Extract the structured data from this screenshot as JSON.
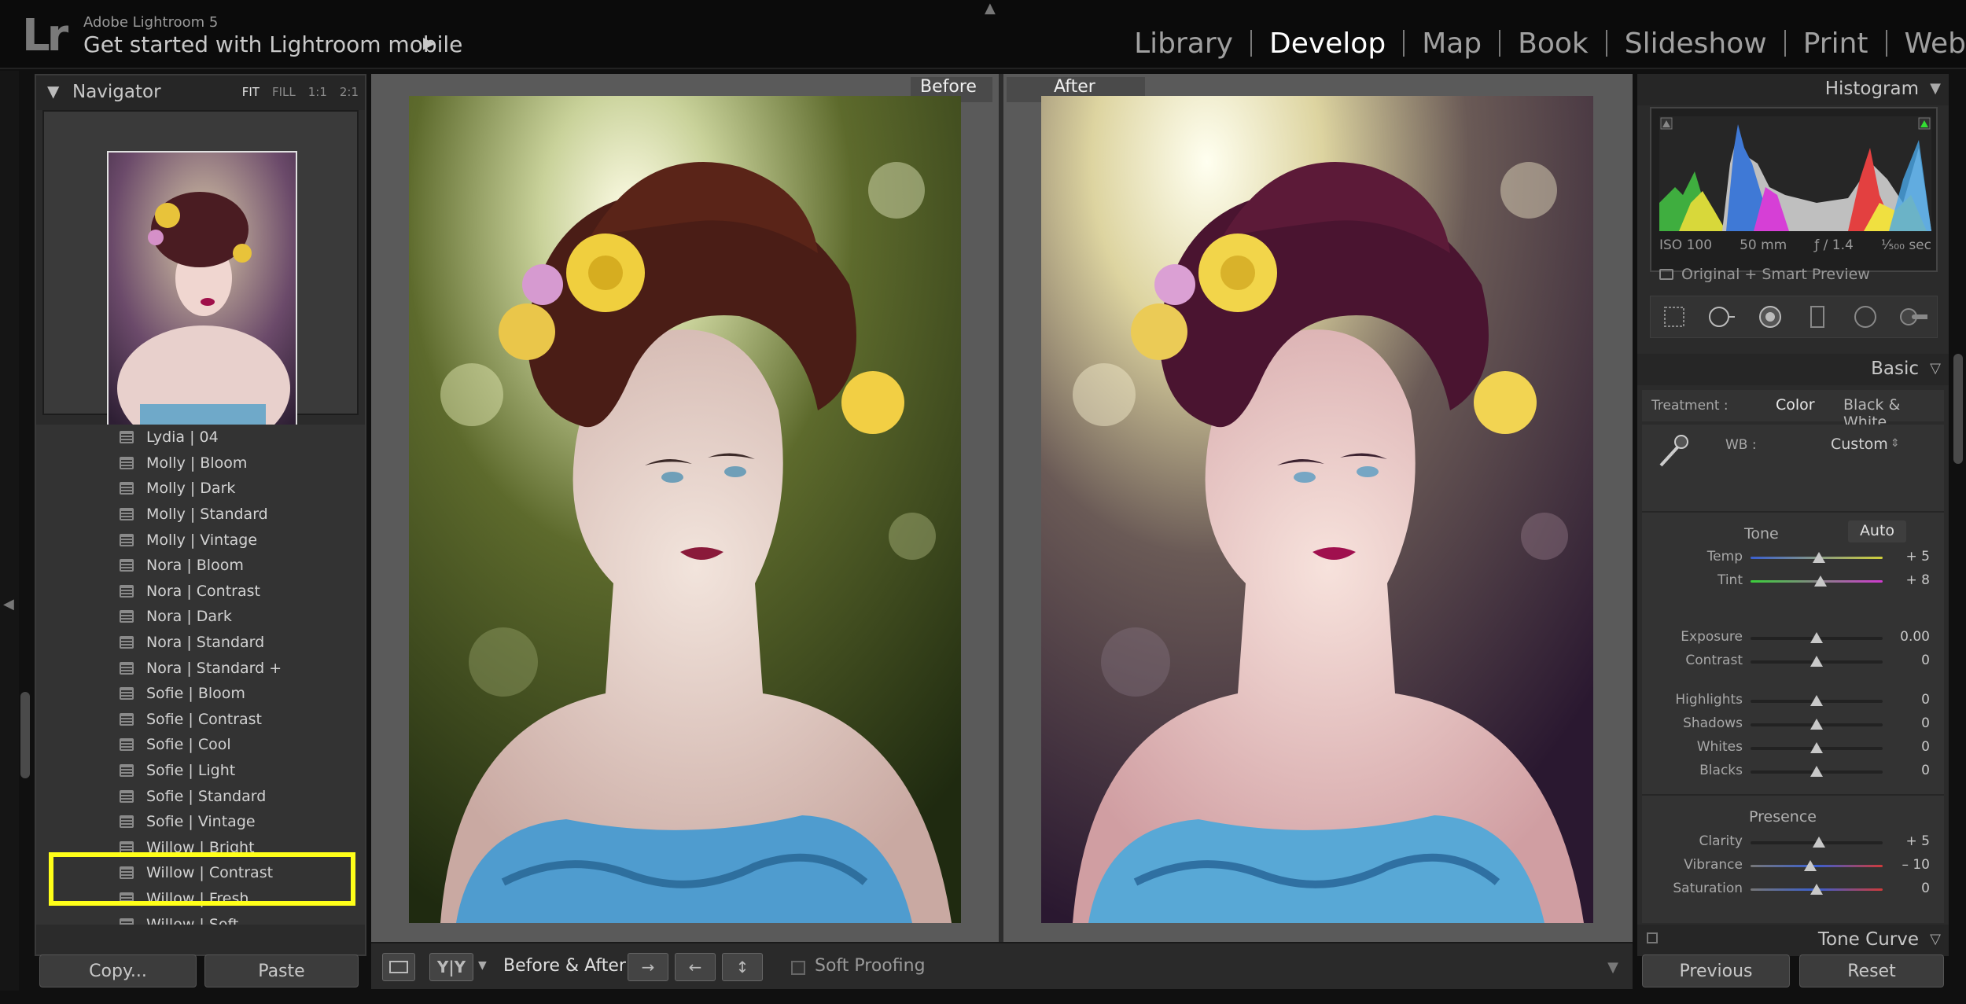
{
  "app": {
    "logo": "Lr",
    "title": "Adobe Lightroom 5",
    "identity": "Get started with Lightroom mobile",
    "identity_arrow": "▶"
  },
  "modules": [
    {
      "label": "Library",
      "active": false
    },
    {
      "label": "Develop",
      "active": true
    },
    {
      "label": "Map",
      "active": false
    },
    {
      "label": "Book",
      "active": false
    },
    {
      "label": "Slideshow",
      "active": false
    },
    {
      "label": "Print",
      "active": false
    },
    {
      "label": "Web",
      "active": false
    }
  ],
  "navigator": {
    "title": "Navigator",
    "zoom": [
      "FIT",
      "FILL",
      "1:1",
      "2:1"
    ],
    "zoom_active": "FIT"
  },
  "presets": [
    "Lydia | 04",
    "Molly | Bloom",
    "Molly | Dark",
    "Molly | Standard",
    "Molly | Vintage",
    "Nora | Bloom",
    "Nora | Contrast",
    "Nora | Dark",
    "Nora | Standard",
    "Nora | Standard +",
    "Sofie | Bloom",
    "Sofie | Contrast",
    "Sofie | Cool",
    "Sofie | Light",
    "Sofie | Standard",
    "Sofie | Vintage",
    "Willow | Bright",
    "Willow | Contrast",
    "Willow | Fresh",
    "Willow | Soft"
  ],
  "highlighted_preset": "Willow | Contrast",
  "left_buttons": {
    "copy": "Copy...",
    "paste": "Paste"
  },
  "view": {
    "before": "Before",
    "after": "After"
  },
  "toolbar": {
    "before_after_label": "Before & After :",
    "soft_proofing": "Soft Proofing",
    "yy": "Y|Y"
  },
  "histogram": {
    "title": "Histogram",
    "iso": "ISO 100",
    "focal": "50 mm",
    "aperture": "ƒ / 1.4",
    "shutter": "¹⁄₅₀₀ sec",
    "preview": "Original + Smart Preview"
  },
  "basic": {
    "title": "Basic",
    "treatment_label": "Treatment :",
    "treatment_color": "Color",
    "treatment_bw": "Black & White",
    "wb_label": "WB :",
    "wb_value": "Custom",
    "tone_label": "Tone",
    "auto_label": "Auto",
    "presence_label": "Presence",
    "sliders": [
      {
        "label": "Temp",
        "value": "+ 5",
        "pos": 0.52
      },
      {
        "label": "Tint",
        "value": "+ 8",
        "pos": 0.53
      },
      {
        "label": "Exposure",
        "value": "0.00",
        "pos": 0.5
      },
      {
        "label": "Contrast",
        "value": "0",
        "pos": 0.5
      },
      {
        "label": "Highlights",
        "value": "0",
        "pos": 0.5
      },
      {
        "label": "Shadows",
        "value": "0",
        "pos": 0.5
      },
      {
        "label": "Whites",
        "value": "0",
        "pos": 0.5
      },
      {
        "label": "Blacks",
        "value": "0",
        "pos": 0.5
      },
      {
        "label": "Clarity",
        "value": "+ 5",
        "pos": 0.52
      },
      {
        "label": "Vibrance",
        "value": "– 10",
        "pos": 0.45
      },
      {
        "label": "Saturation",
        "value": "0",
        "pos": 0.5
      }
    ]
  },
  "tone_curve": {
    "title": "Tone Curve"
  },
  "right_buttons": {
    "previous": "Previous",
    "reset": "Reset"
  },
  "colors": {
    "highlight": "#ffff19",
    "active_module": "#ffffff",
    "panel": "#2b2b2b"
  }
}
